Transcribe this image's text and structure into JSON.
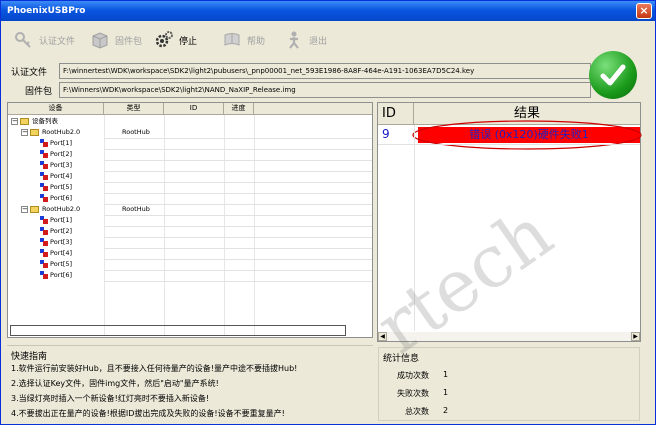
{
  "window": {
    "title": "PhoenixUSBPro",
    "close_glyph": "×"
  },
  "toolbar": {
    "items": [
      {
        "label": "认证文件",
        "icon": "key-icon",
        "enabled": false
      },
      {
        "label": "固件包",
        "icon": "package-icon",
        "enabled": false
      },
      {
        "label": "停止",
        "icon": "gear-icon",
        "enabled": true
      },
      {
        "label": "帮助",
        "icon": "help-icon",
        "enabled": false
      },
      {
        "label": "退出",
        "icon": "exit-icon",
        "enabled": false
      }
    ]
  },
  "paths": {
    "auth_label": "认证文件",
    "auth_value": "F:\\winnertest\\WDK\\workspace\\SDK2\\light2\\pubusers\\_pnp00001_net_593E1986-8A8F-464e-A191-1063EA7D5C24.key",
    "firmware_label": "固件包",
    "firmware_value": "F:\\Winners\\WDK\\workspace\\SDK2\\light2\\NAND_NaXIP_Release.img"
  },
  "status_icon": "checkmark-icon",
  "device_grid": {
    "headers": [
      "设备",
      "类型",
      "ID",
      "进度"
    ],
    "root": "设备列表",
    "hubs": [
      {
        "name": "RootHub2.0",
        "type": "RootHub",
        "ports": [
          "Port[1]",
          "Port[2]",
          "Port[3]",
          "Port[4]",
          "Port[5]",
          "Port[6]"
        ]
      },
      {
        "name": "RootHub2.0",
        "type": "RootHub",
        "ports": [
          "Port[1]",
          "Port[2]",
          "Port[3]",
          "Port[4]",
          "Port[5]",
          "Port[6]"
        ]
      }
    ]
  },
  "results": {
    "headers": [
      "ID",
      "结果"
    ],
    "rows": [
      {
        "id": "9",
        "result": "错误 (0x120)硬件失败1"
      }
    ],
    "error_color": "#ff0000"
  },
  "guide": {
    "title": "快速指南",
    "lines": [
      "1.软件运行前安装好Hub，且不要接入任何待量产的设备!量产中途不要插拔Hub!",
      "2.选择认证Key文件，固件img文件，然后\"启动\"量产系统!",
      "3.当绿灯亮时插入一个新设备!红灯亮时不要插入新设备!",
      "4.不要拔出正在量产的设备!根据ID拔出完成及失败的设备!设备不要重复量产!"
    ]
  },
  "stats": {
    "title": "统计信息",
    "rows": [
      {
        "label": "成功次数",
        "value": "1"
      },
      {
        "label": "失败次数",
        "value": "1"
      },
      {
        "label": "总次数",
        "value": "2"
      }
    ]
  },
  "watermark": {
    "text": "rtech"
  }
}
